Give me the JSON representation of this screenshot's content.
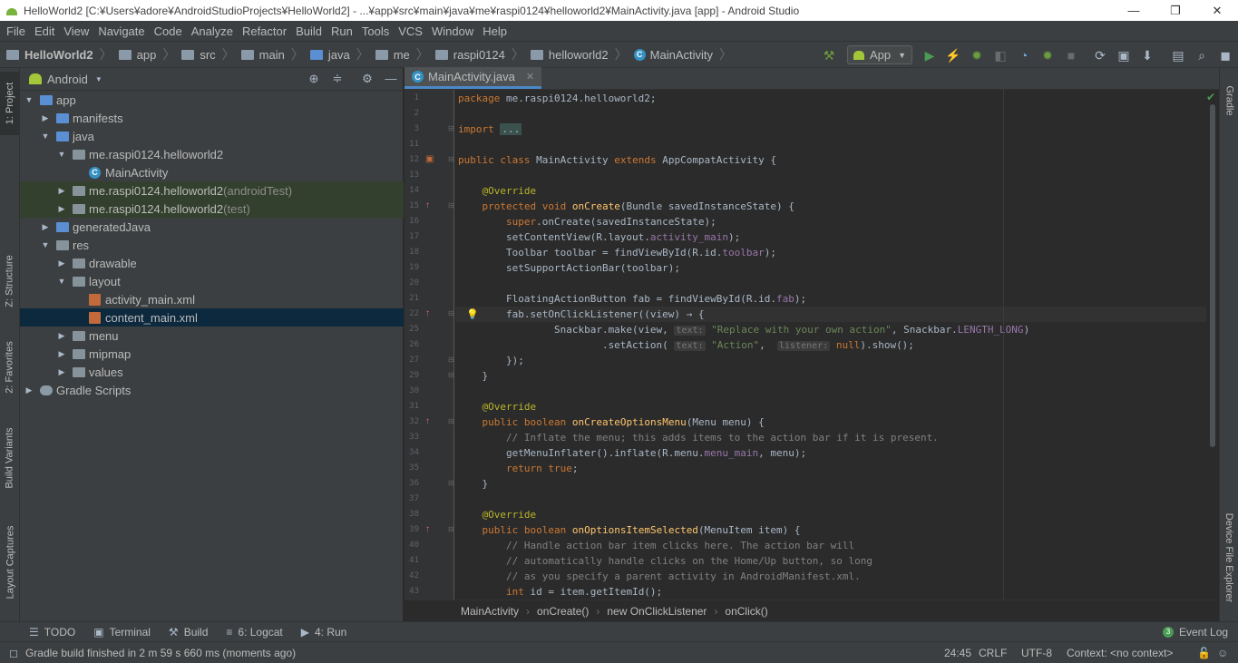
{
  "window": {
    "title": "HelloWorld2 [C:¥Users¥adore¥AndroidStudioProjects¥HelloWorld2] - ...¥app¥src¥main¥java¥me¥raspi0124¥helloworld2¥MainActivity.java [app] - Android Studio",
    "minimize": "—",
    "restore": "❐",
    "close": "✕"
  },
  "menu": [
    "File",
    "Edit",
    "View",
    "Navigate",
    "Code",
    "Analyze",
    "Refactor",
    "Build",
    "Run",
    "Tools",
    "VCS",
    "Window",
    "Help"
  ],
  "breadcrumbs": [
    "HelloWorld2",
    "app",
    "src",
    "main",
    "java",
    "me",
    "raspi0124",
    "helloworld2",
    "MainActivity"
  ],
  "run_config": "App",
  "project": {
    "view": "Android",
    "tree": [
      {
        "label": "app",
        "extra": ""
      },
      {
        "label": "manifests",
        "extra": ""
      },
      {
        "label": "java",
        "extra": ""
      },
      {
        "label": "me.raspi0124.helloworld2",
        "extra": ""
      },
      {
        "label": "MainActivity",
        "extra": ""
      },
      {
        "label": "me.raspi0124.helloworld2",
        "extra": " (androidTest)"
      },
      {
        "label": "me.raspi0124.helloworld2",
        "extra": " (test)"
      },
      {
        "label": "generatedJava",
        "extra": ""
      },
      {
        "label": "res",
        "extra": ""
      },
      {
        "label": "drawable",
        "extra": ""
      },
      {
        "label": "layout",
        "extra": ""
      },
      {
        "label": "activity_main.xml",
        "extra": ""
      },
      {
        "label": "content_main.xml",
        "extra": ""
      },
      {
        "label": "menu",
        "extra": ""
      },
      {
        "label": "mipmap",
        "extra": ""
      },
      {
        "label": "values",
        "extra": ""
      },
      {
        "label": "Gradle Scripts",
        "extra": ""
      }
    ]
  },
  "left_tabs": {
    "project": "1: Project",
    "structure": "Z: Structure",
    "favorites": "2: Favorites",
    "build_variants": "Build Variants",
    "layout_captures": "Layout Captures"
  },
  "right_tabs": {
    "gradle": "Gradle",
    "device_file_explorer": "Device File Explorer"
  },
  "editor": {
    "tab": "MainActivity.java",
    "line_numbers": [
      "1",
      "2",
      "3",
      "11",
      "12",
      "13",
      "14",
      "15",
      "16",
      "17",
      "18",
      "19",
      "20",
      "21",
      "22",
      "25",
      "26",
      "27",
      "29",
      "30",
      "31",
      "32",
      "33",
      "34",
      "35",
      "36",
      "37",
      "38",
      "39",
      "40",
      "41",
      "42",
      "43"
    ],
    "code": [
      "package me.raspi0124.helloworld2;",
      "",
      "import ...",
      "",
      "public class MainActivity extends AppCompatActivity {",
      "",
      "    @Override",
      "    protected void onCreate(Bundle savedInstanceState) {",
      "        super.onCreate(savedInstanceState);",
      "        setContentView(R.layout.activity_main);",
      "        Toolbar toolbar = findViewById(R.id.toolbar);",
      "        setSupportActionBar(toolbar);",
      "",
      "        FloatingActionButton fab = findViewById(R.id.fab);",
      "        fab.setOnClickListener((view) → {",
      "                Snackbar.make(view, text: \"Replace with your own action\", Snackbar.LENGTH_LONG)",
      "                        .setAction( text: \"Action\",  listener: null).show();",
      "        });",
      "    }",
      "",
      "    @Override",
      "    public boolean onCreateOptionsMenu(Menu menu) {",
      "        // Inflate the menu; this adds items to the action bar if it is present.",
      "        getMenuInflater().inflate(R.menu.menu_main, menu);",
      "        return true;",
      "    }",
      "",
      "    @Override",
      "    public boolean onOptionsItemSelected(MenuItem item) {",
      "        // Handle action bar item clicks here. The action bar will",
      "        // automatically handle clicks on the Home/Up button, so long",
      "        // as you specify a parent activity in AndroidManifest.xml.",
      "        int id = item.getItemId();"
    ]
  },
  "editor_breadcrumb": [
    "MainActivity",
    "onCreate()",
    "new OnClickListener",
    "onClick()"
  ],
  "tool_windows": {
    "todo": "TODO",
    "terminal": "Terminal",
    "build": "Build",
    "logcat": "6: Logcat",
    "run": "4: Run",
    "event_log": "Event Log",
    "event_count": "3"
  },
  "status": {
    "message": "Gradle build finished in 2 m 59 s 660 ms (moments ago)",
    "position": "24:45",
    "line_sep": "CRLF",
    "encoding": "UTF-8",
    "context": "Context: <no context>"
  },
  "colors": {
    "accent": "#4a88c7",
    "keyword": "#cc7832",
    "function": "#ffc66d",
    "string": "#6a8759",
    "annotation": "#bbb529",
    "field": "#9876aa",
    "comment": "#808080"
  }
}
